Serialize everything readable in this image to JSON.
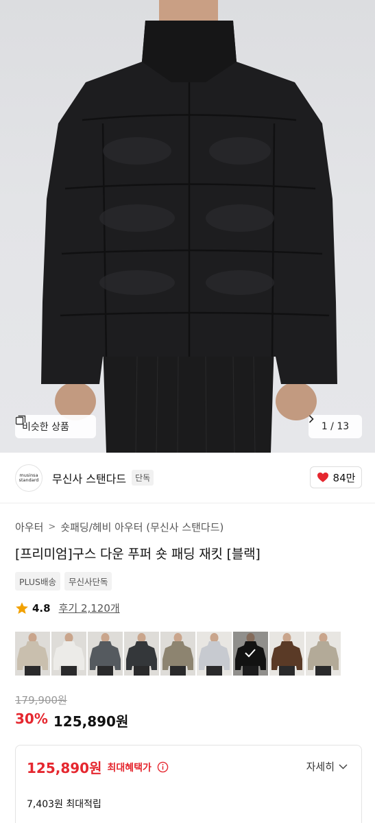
{
  "hero": {
    "similar_label": "비슷한 상품",
    "image_index": "1 / 13"
  },
  "brand": {
    "logo_line1": "musinsa",
    "logo_line2": "standard",
    "name": "무신사 스탠다드",
    "exclusive_tag": "단독",
    "likes": "84만"
  },
  "breadcrumb": [
    "아우터",
    "숏패딩/헤비 아우터 (무신사 스탠다드)"
  ],
  "breadcrumb_sep": ">",
  "product": {
    "title": "[프리미엄]구스 다운 푸퍼 숏 패딩 재킷 [블랙]",
    "tags": [
      "PLUS배송",
      "무신사단독"
    ],
    "rating": "4.8",
    "reviews": "후기 2,120개"
  },
  "color_options": [
    {
      "name": "beige",
      "color": "#c9bfae"
    },
    {
      "name": "white",
      "color": "#ecebe8"
    },
    {
      "name": "charcoal",
      "color": "#555a5f"
    },
    {
      "name": "dark-gray",
      "color": "#34373a"
    },
    {
      "name": "khaki",
      "color": "#8d8470"
    },
    {
      "name": "light-gray",
      "color": "#c7cad0"
    },
    {
      "name": "black",
      "color": "#1c1c1d",
      "selected": true
    },
    {
      "name": "brown",
      "color": "#5a3a26"
    },
    {
      "name": "taupe",
      "color": "#b3aa98"
    }
  ],
  "price": {
    "original": "179,900원",
    "discount": "30%",
    "sale": "125,890원"
  },
  "benefit": {
    "price": "125,890원",
    "label": "최대혜택가",
    "detail_label": "자세히",
    "points": "7,403원 최대적립"
  },
  "colors": {
    "accent_red": "#e5272f",
    "star": "#f2a100"
  }
}
